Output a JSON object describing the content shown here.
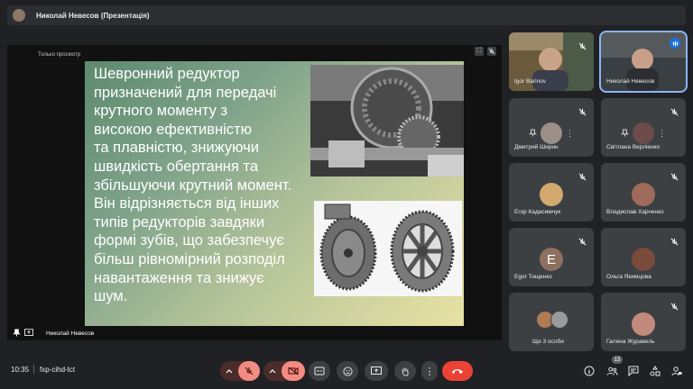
{
  "topbar": {
    "title": "Николай Невесов (Презентація)"
  },
  "stage": {
    "view_only": "Только просмотр",
    "presenter_name": "Николай Невесов",
    "slide_lines": [
      "Шевронний редуктор",
      "призначений для передачі",
      "крутного моменту з",
      "високою ефективністю",
      "та плавністю, знижуючи",
      "швидкість обертання та",
      "збільшуючи крутний момент.",
      "Він відрізняється від інших",
      "типів редукторів завдяки",
      "формі зубів, що забезпечує",
      "більш рівномірний розподіл",
      "навантаження та знижує",
      "шум."
    ]
  },
  "participants": [
    {
      "name": "Igor Barinov"
    },
    {
      "name": "Николай Невесов"
    },
    {
      "name": "Дмитрий Ширин"
    },
    {
      "name": "Світлана Верліенко"
    },
    {
      "name": "Егор Кадасимчук"
    },
    {
      "name": "Владислав Харченко"
    },
    {
      "name": "Egor Тищенко",
      "initial": "E"
    },
    {
      "name": "Ольга Якимцова"
    },
    {
      "name": "Ще 3 особи"
    },
    {
      "name": "Галина Журавель"
    }
  ],
  "bottom": {
    "time": "10:35",
    "meeting_code": "fxp-cihd-tct",
    "participant_count": "13"
  },
  "colors": {
    "accent": "#8ab4f8",
    "end_call": "#ea4335",
    "muted": "#f28b82"
  }
}
